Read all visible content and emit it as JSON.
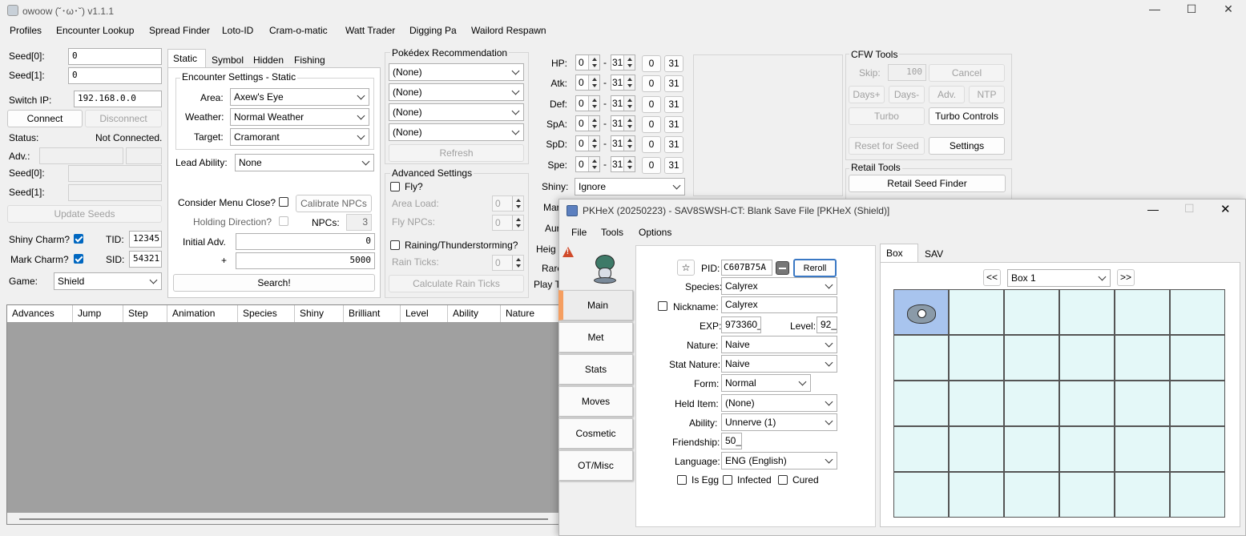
{
  "app": {
    "title": "owoow (˘･ω･˘) v1.1.1"
  },
  "menu": [
    "Profiles",
    "Encounter Lookup",
    "Spread Finder",
    "Loto-ID",
    "Cram-o-matic",
    "Watt Trader",
    "Digging Pa",
    "Wailord Respawn"
  ],
  "left": {
    "seed0_label": "Seed[0]:",
    "seed0_value": "0",
    "seed1_label": "Seed[1]:",
    "seed1_value": "0",
    "switch_ip_label": "Switch IP:",
    "switch_ip_value": "192.168.0.0",
    "connect": "Connect",
    "disconnect": "Disconnect",
    "status_label": "Status:",
    "status_value": "Not Connected.",
    "adv_label": "Adv.:",
    "seed0b_label": "Seed[0]:",
    "seed1b_label": "Seed[1]:",
    "update_seeds": "Update Seeds",
    "shiny_charm": "Shiny Charm?",
    "mark_charm": "Mark Charm?",
    "tid_label": "TID:",
    "tid_value": "12345",
    "sid_label": "SID:",
    "sid_value": "54321",
    "game_label": "Game:",
    "game_value": "Shield"
  },
  "encounter": {
    "tabs": [
      "Static",
      "Symbol",
      "Hidden",
      "Fishing"
    ],
    "group_title": "Encounter Settings - Static",
    "area_label": "Area:",
    "area_value": "Axew's Eye",
    "weather_label": "Weather:",
    "weather_value": "Normal Weather",
    "target_label": "Target:",
    "target_value": "Cramorant",
    "lead_label": "Lead Ability:",
    "lead_value": "None",
    "menu_close": "Consider Menu Close?",
    "calibrate": "Calibrate NPCs",
    "holding": "Holding Direction?",
    "npcs_label": "NPCs:",
    "npcs_value": "3",
    "initial_label": "Initial Adv.",
    "initial_value": "0",
    "plus_label": "+",
    "plus_value": "5000",
    "search": "Search!"
  },
  "pokedex": {
    "title": "Pokédex Recommendation",
    "options": [
      "(None)",
      "(None)",
      "(None)",
      "(None)"
    ],
    "refresh": "Refresh",
    "adv_title": "Advanced Settings",
    "fly": "Fly?",
    "area_load": "Area Load:",
    "area_load_value": "0",
    "fly_npcs": "Fly NPCs:",
    "fly_npcs_value": "0",
    "raining": "Raining/Thunderstorming?",
    "rain_ticks": "Rain Ticks:",
    "rain_ticks_value": "0",
    "calc_rain": "Calculate Rain Ticks"
  },
  "ivs": {
    "rows": [
      {
        "label": "HP:",
        "min": "0",
        "max": "31",
        "a": "0",
        "b": "31"
      },
      {
        "label": "Atk:",
        "min": "0",
        "max": "31",
        "a": "0",
        "b": "31"
      },
      {
        "label": "Def:",
        "min": "0",
        "max": "31",
        "a": "0",
        "b": "31"
      },
      {
        "label": "SpA:",
        "min": "0",
        "max": "31",
        "a": "0",
        "b": "31"
      },
      {
        "label": "SpD:",
        "min": "0",
        "max": "31",
        "a": "0",
        "b": "31"
      },
      {
        "label": "Spe:",
        "min": "0",
        "max": "31",
        "a": "0",
        "b": "31"
      }
    ],
    "dash": "-",
    "shiny_label": "Shiny:",
    "shiny_value": "Ignore",
    "partial": [
      "Mar",
      "Aur",
      "Heig",
      "Rare",
      "Play T"
    ]
  },
  "cfw": {
    "title": "CFW Tools",
    "skip_label": "Skip:",
    "skip_value": "100",
    "cancel": "Cancel",
    "days_plus": "Days+",
    "days_minus": "Days-",
    "adv": "Adv.",
    "ntp": "NTP",
    "turbo": "Turbo",
    "turbo_controls": "Turbo Controls",
    "reset_for_seed": "Reset for Seed",
    "settings": "Settings",
    "retail_title": "Retail Tools",
    "retail_finder": "Retail Seed Finder"
  },
  "results": {
    "columns": [
      "Advances",
      "Jump",
      "Step",
      "Animation",
      "Species",
      "Shiny",
      "Brilliant",
      "Level",
      "Ability",
      "Nature"
    ]
  },
  "pkhex": {
    "title": "PKHeX (20250223) - SAV8SWSH-CT: Blank Save File [PKHeX (Shield)]",
    "menu": [
      "File",
      "Tools",
      "Options"
    ],
    "tabs": [
      "Main",
      "Met",
      "Stats",
      "Moves",
      "Cosmetic",
      "OT/Misc"
    ],
    "star": "☆",
    "pid_label": "PID:",
    "pid_value": "C607B75A",
    "reroll": "Reroll",
    "species_label": "Species:",
    "species_value": "Calyrex",
    "nickname_label": "Nickname:",
    "nickname_value": "Calyrex",
    "exp_label": "EXP:",
    "exp_value": "973360_",
    "level_label": "Level:",
    "level_value": "92_",
    "nature_label": "Nature:",
    "nature_value": "Naive",
    "stat_nature_label": "Stat Nature:",
    "stat_nature_value": "Naive",
    "form_label": "Form:",
    "form_value": "Normal",
    "held_label": "Held Item:",
    "held_value": "(None)",
    "ability_label": "Ability:",
    "ability_value": "Unnerve (1)",
    "friendship_label": "Friendship:",
    "friendship_value": "50_",
    "language_label": "Language:",
    "language_value": "ENG (English)",
    "is_egg": "Is Egg",
    "infected": "Infected",
    "cured": "Cured",
    "box_tabs": [
      "Box",
      "SAV"
    ],
    "prev": "<<",
    "next": ">>",
    "box_value": "Box 1"
  }
}
